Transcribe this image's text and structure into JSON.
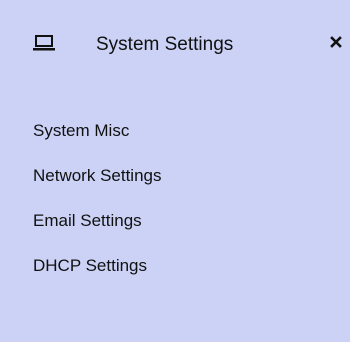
{
  "panel": {
    "title": "System Settings",
    "header_icon": "laptop-icon",
    "close_icon": "close-icon",
    "background_color": "#cbd2f5",
    "text_color": "#111111"
  },
  "menu": {
    "items": [
      {
        "label": "System Misc"
      },
      {
        "label": "Network Settings"
      },
      {
        "label": "Email Settings"
      },
      {
        "label": "DHCP Settings"
      }
    ]
  }
}
